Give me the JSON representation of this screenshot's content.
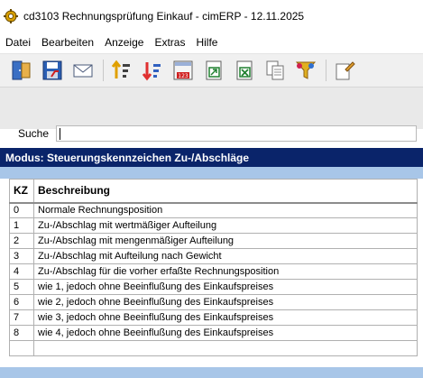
{
  "window": {
    "title": "cd3103 Rechnungsprüfung Einkauf - cimERP - 12.11.2025"
  },
  "menu": {
    "items": [
      "Datei",
      "Bearbeiten",
      "Anzeige",
      "Extras",
      "Hilfe"
    ]
  },
  "toolbar": {
    "buttons": [
      {
        "icon": "exit-door-icon"
      },
      {
        "icon": "save-floppy-icon"
      },
      {
        "icon": "mail-envelope-icon"
      },
      {
        "icon": "sort-ascending-icon"
      },
      {
        "icon": "sort-descending-icon"
      },
      {
        "icon": "calendar-123-icon"
      },
      {
        "icon": "export-document-icon"
      },
      {
        "icon": "excel-export-icon"
      },
      {
        "icon": "copy-pages-icon"
      },
      {
        "icon": "filter-funnel-icon"
      },
      {
        "icon": "document-edit-icon"
      }
    ]
  },
  "search": {
    "label": "Suche",
    "value": ""
  },
  "mode": {
    "label": "Modus: Steuerungskennzeichen Zu-/Abschläge"
  },
  "table": {
    "columns": [
      "KZ",
      "Beschreibung"
    ],
    "rows": [
      [
        "0",
        "Normale Rechnungsposition"
      ],
      [
        "1",
        "Zu-/Abschlag mit wertmäßiger Aufteilung"
      ],
      [
        "2",
        "Zu-/Abschlag mit mengenmäßiger Aufteilung"
      ],
      [
        "3",
        "Zu-/Abschlag mit Aufteilung nach Gewicht"
      ],
      [
        "4",
        "Zu-/Abschlag für die vorher erfaßte Rechnungsposition"
      ],
      [
        "5",
        "wie 1, jedoch ohne Beeinflußung des Einkaufspreises"
      ],
      [
        "6",
        "wie 2, jedoch ohne Beeinflußung des Einkaufspreises"
      ],
      [
        "7",
        "wie 3, jedoch ohne Beeinflußung des Einkaufspreises"
      ],
      [
        "8",
        "wie 4, jedoch ohne Beeinflußung des Einkaufspreises"
      ]
    ]
  },
  "colors": {
    "mode_bar": "#0a246a",
    "selection_blue": "#a8c6e8"
  }
}
